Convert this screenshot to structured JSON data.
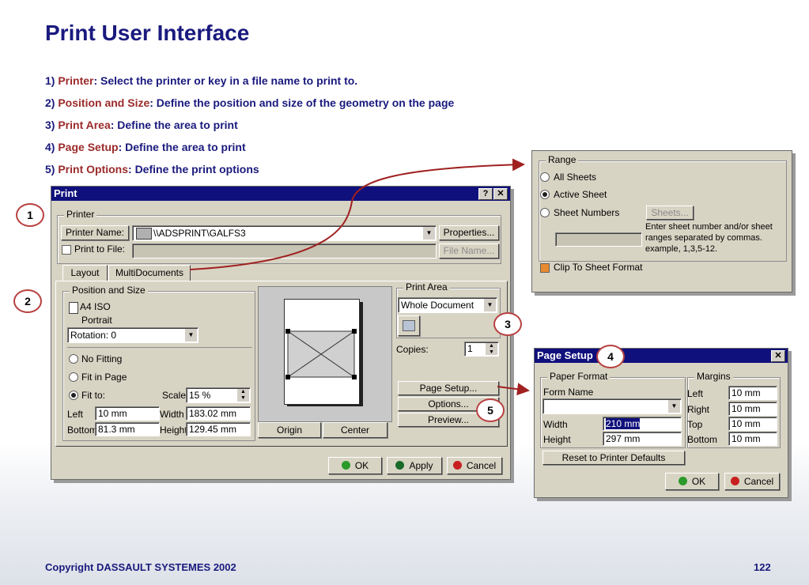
{
  "slide": {
    "title": "Print User Interface",
    "bullets": [
      {
        "num": "1)",
        "term": "Printer",
        "rest": ": Select the printer or key in a file name to print to."
      },
      {
        "num": "2)",
        "term": "Position and Size",
        "rest": ": Define the position and size of the geometry on the page"
      },
      {
        "num": "3)",
        "term": "Print Area",
        "rest": ": Define the area to print"
      },
      {
        "num": "4)",
        "term": "Page Setup",
        "rest": ": Define the area to print"
      },
      {
        "num": "5)",
        "term": "Print Options",
        "rest": ": Define the print options"
      }
    ],
    "copyright": "Copyright DASSAULT SYSTEMES 2002",
    "page_number": "122",
    "callouts": [
      "1",
      "2",
      "3",
      "4",
      "5"
    ]
  },
  "print_dialog": {
    "title": "Print",
    "help_btn": "?",
    "close_btn": "✕",
    "printer_group": "Printer",
    "printer_name_btn": "Printer Name:",
    "printer_name_value": "\\\\ADSPRINT\\GALFS3",
    "properties_btn": "Properties...",
    "print_to_file_label": "Print to File:",
    "file_name_btn": "File Name...",
    "tabs": [
      "Layout",
      "MultiDocuments"
    ],
    "position_group": "Position and Size",
    "paper_format": "A4 ISO",
    "orientation": "Portrait",
    "rotation_value": "Rotation: 0",
    "no_fitting": "No Fitting",
    "fit_in_page": "Fit in Page",
    "fit_to": "Fit to:",
    "scale_label": "Scale",
    "scale_value": "15 %",
    "left_label": "Left",
    "left_value": "10 mm",
    "width_label": "Width",
    "width_value": "183.02 mm",
    "bottom_label": "Bottom",
    "bottom_value": "81.3 mm",
    "height_label": "Height",
    "height_value": "129.45 mm",
    "origin_btn": "Origin",
    "center_btn": "Center",
    "print_area_group": "Print Area",
    "print_area_value": "Whole Document",
    "copies_label": "Copies:",
    "copies_value": "1",
    "page_setup_btn": "Page Setup...",
    "options_btn": "Options...",
    "preview_btn": "Preview...",
    "ok_btn": "OK",
    "apply_btn": "Apply",
    "cancel_btn": "Cancel"
  },
  "range_panel": {
    "group": "Range",
    "all_sheets": "All Sheets",
    "active_sheet": "Active Sheet",
    "sheet_numbers": "Sheet Numbers",
    "sheets_btn": "Sheets...",
    "hint_line1": "Enter sheet number and/or sheet",
    "hint_line2": "ranges separated by commas.",
    "hint_line3": "example, 1,3,5-12.",
    "clip_label": "Clip To Sheet Format"
  },
  "page_setup_dialog": {
    "title": "Page Setup",
    "close_btn": "✕",
    "paper_format_group": "Paper Format",
    "form_name_label": "Form Name",
    "form_name_value": "",
    "width_label": "Width",
    "width_value": "210 mm",
    "height_label": "Height",
    "height_value": "297 mm",
    "margins_group": "Margins",
    "left_label": "Left",
    "left_value": "10 mm",
    "right_label": "Right",
    "right_value": "10 mm",
    "top_label": "Top",
    "top_value": "10 mm",
    "bottom_label": "Bottom",
    "bottom_value": "10 mm",
    "reset_btn": "Reset to Printer Defaults",
    "ok_btn": "OK",
    "cancel_btn": "Cancel"
  },
  "colors": {
    "title_blue": "#1a1a7e",
    "highlight_red": "#9b2a2a",
    "titlebar": "#10107c",
    "ok_green": "#2a9a2a",
    "cancel_red": "#c82020"
  }
}
